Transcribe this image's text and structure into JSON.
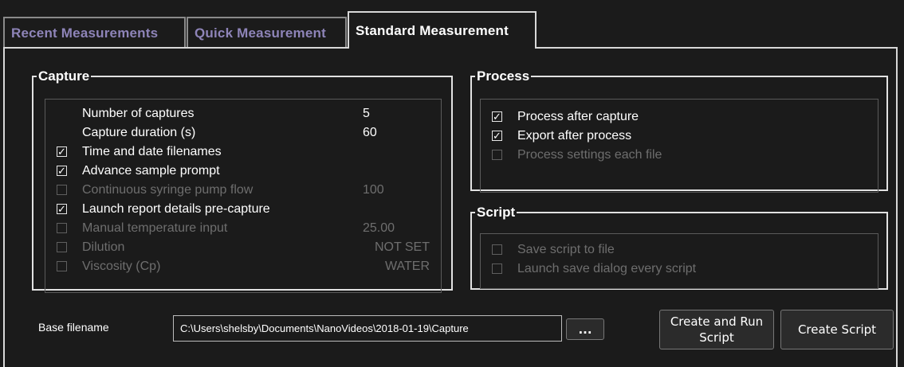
{
  "tabs": {
    "recent": "Recent Measurements",
    "quick": "Quick Measurement",
    "standard": "Standard Measurement"
  },
  "capture": {
    "title": "Capture",
    "rows": [
      {
        "label": "Number of captures",
        "value": "5",
        "checkbox": false,
        "enabled": true
      },
      {
        "label": "Capture duration (s)",
        "value": "60",
        "checkbox": false,
        "enabled": true
      },
      {
        "label": "Time and date filenames",
        "value": "",
        "checkbox": true,
        "checked": true,
        "enabled": true
      },
      {
        "label": "Advance sample prompt",
        "value": "",
        "checkbox": true,
        "checked": true,
        "enabled": true
      },
      {
        "label": "Continuous syringe pump flow",
        "value": "100",
        "checkbox": true,
        "checked": false,
        "enabled": false
      },
      {
        "label": "Launch report details pre-capture",
        "value": "",
        "checkbox": true,
        "checked": true,
        "enabled": true
      },
      {
        "label": "Manual temperature input",
        "value": "25.00",
        "checkbox": true,
        "checked": false,
        "enabled": false
      },
      {
        "label": "Dilution",
        "value": "NOT SET",
        "checkbox": true,
        "checked": false,
        "enabled": false
      },
      {
        "label": "Viscosity (Cp)",
        "value": "WATER",
        "checkbox": true,
        "checked": false,
        "enabled": false
      }
    ]
  },
  "process": {
    "title": "Process",
    "rows": [
      {
        "label": "Process after capture",
        "checked": true,
        "enabled": true
      },
      {
        "label": "Export after process",
        "checked": true,
        "enabled": true
      },
      {
        "label": "Process settings each file",
        "checked": false,
        "enabled": false
      }
    ]
  },
  "script": {
    "title": "Script",
    "rows": [
      {
        "label": "Save script to file",
        "checked": false,
        "enabled": false
      },
      {
        "label": "Launch save dialog every script",
        "checked": false,
        "enabled": false
      }
    ]
  },
  "footer": {
    "base_filename_label": "Base filename",
    "base_filename_value": "C:\\Users\\shelsby\\Documents\\NanoVideos\\2018-01-19\\Capture",
    "browse_label": "...",
    "create_run_label": "Create and Run Script",
    "create_label": "Create Script"
  },
  "colors": {
    "background": "#1b1b1b",
    "inactive_tab_text": "#8e84b8",
    "disabled_text": "#6e6e6e"
  }
}
